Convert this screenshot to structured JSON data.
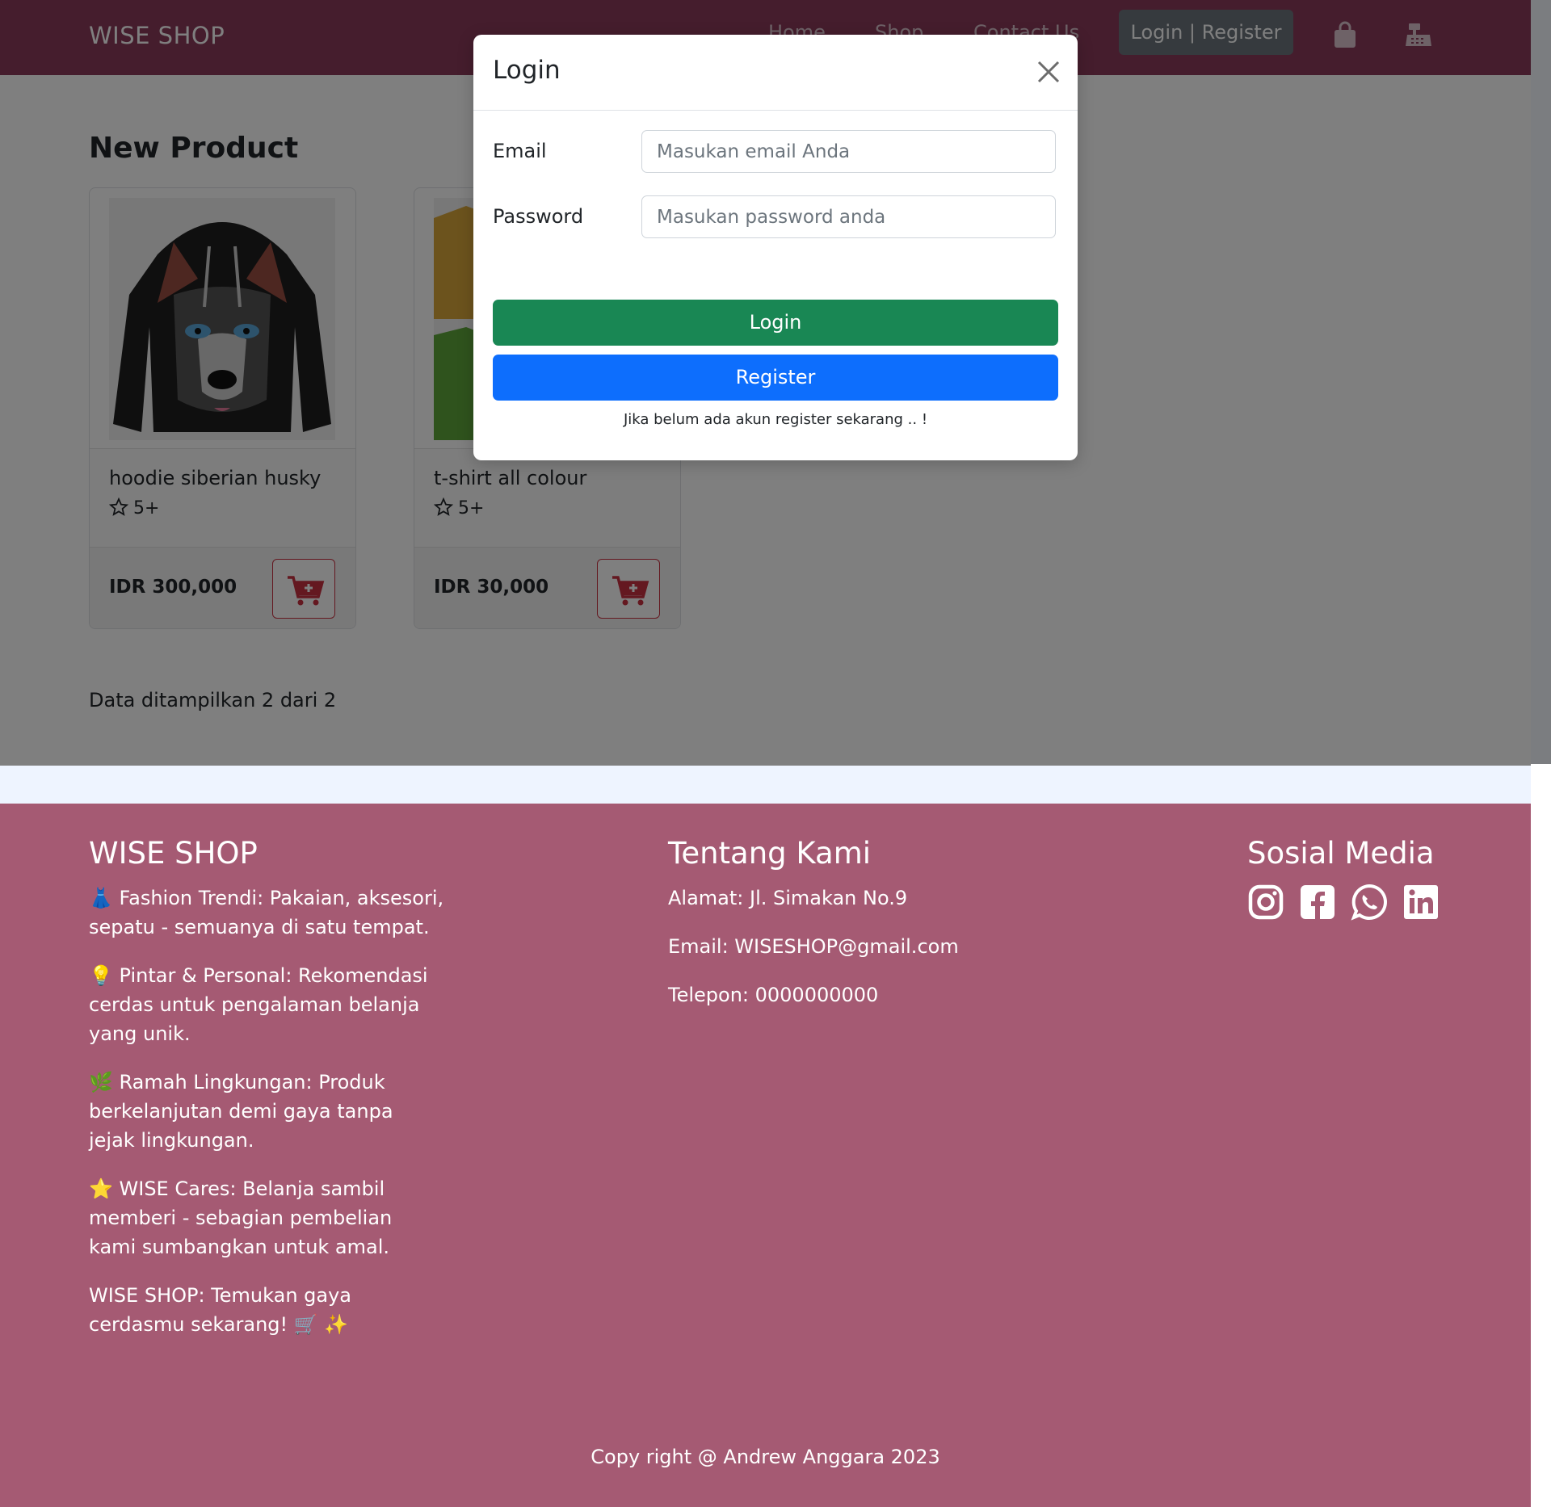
{
  "navbar": {
    "brand": "WISE SHOP",
    "links": [
      "Home",
      "Shop",
      "Contact Us"
    ],
    "login_register": "Login | Register",
    "icons": [
      "shopping-bag-icon",
      "cash-register-icon"
    ]
  },
  "main": {
    "section_title": "New Product",
    "products": [
      {
        "name": "hoodie siberian husky",
        "rating": "5+",
        "price": "IDR 300,000",
        "image": "husky-hoodie-image"
      },
      {
        "name": "t-shirt all colour",
        "rating": "5+",
        "price": "IDR 30,000",
        "image": "t-shirts-image"
      }
    ],
    "data_note": "Data ditampilkan 2 dari 2"
  },
  "modal": {
    "title": "Login",
    "email_label": "Email",
    "email_placeholder": "Masukan email Anda",
    "password_label": "Password",
    "password_placeholder": "Masukan password anda",
    "login_button": "Login",
    "register_button": "Register",
    "note": "Jika belum ada akun register sekarang .. !"
  },
  "footer": {
    "brand": "WISE SHOP",
    "features": [
      "👗 Fashion Trendi: Pakaian, aksesori, sepatu - semuanya di satu tempat.",
      "💡 Pintar & Personal: Rekomendasi cerdas untuk pengalaman belanja yang unik.",
      "🌿 Ramah Lingkungan: Produk berkelanjutan demi gaya tanpa jejak lingkungan.",
      "⭐ WISE Cares: Belanja sambil memberi - sebagian pembelian kami sumbangkan untuk amal.",
      "WISE SHOP: Temukan gaya cerdasmu sekarang! 🛒 ✨"
    ],
    "about_title": "Tentang Kami",
    "address": "Alamat: Jl. Simakan No.9",
    "email": "Email: WISESHOP@gmail.com",
    "phone": "Telepon: 0000000000",
    "social_title": "Sosial Media",
    "social_icons": [
      "instagram-icon",
      "facebook-icon",
      "whatsapp-icon",
      "linkedin-icon"
    ],
    "copyright": "Copy right @ Andrew Anggara 2023"
  },
  "colors": {
    "navbar": "#8b3a5b",
    "footer": "#a55a73",
    "login_green": "#198754",
    "register_blue": "#0d6efd",
    "cart_red": "#c83040"
  }
}
